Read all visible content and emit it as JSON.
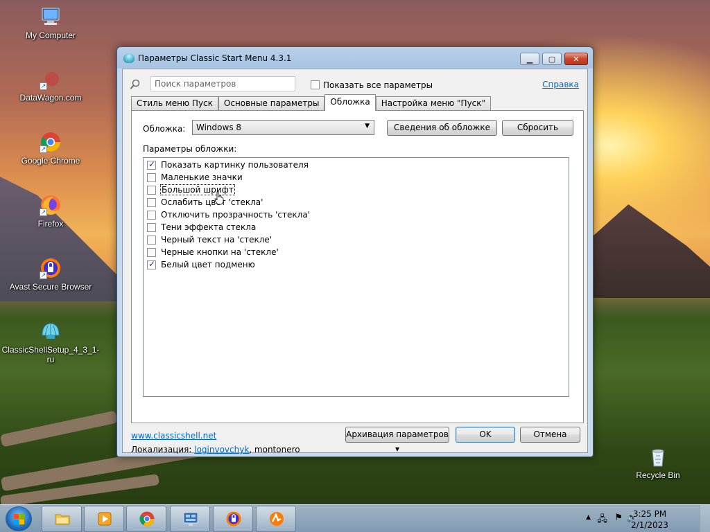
{
  "desktop": {
    "icons": [
      {
        "label": "My Computer",
        "icon": "computer-icon"
      },
      {
        "label": "DataWagon.com",
        "icon": "web-shortcut-icon"
      },
      {
        "label": "Google Chrome",
        "icon": "chrome-icon"
      },
      {
        "label": "Firefox",
        "icon": "firefox-icon"
      },
      {
        "label": "Avast Secure Browser",
        "icon": "avast-browser-icon"
      },
      {
        "label": "ClassicShellSetup_4_3_1-ru",
        "icon": "classic-shell-icon"
      }
    ],
    "recycle_bin": {
      "label": "Recycle Bin",
      "icon": "recycle-bin-icon"
    }
  },
  "window": {
    "title": "Параметры Classic Start Menu 4.3.1",
    "buttons": {
      "minimize": "▁",
      "maximize": "▢",
      "close": "✕"
    },
    "search": {
      "placeholder": "Поиск параметров"
    },
    "show_all": {
      "label": "Показать все параметры",
      "checked": false
    },
    "help_link": "Справка",
    "tabs": [
      {
        "label": "Стиль меню Пуск",
        "active": false
      },
      {
        "label": "Основные параметры",
        "active": false
      },
      {
        "label": "Обложка",
        "active": true
      },
      {
        "label": "Настройка меню \"Пуск\"",
        "active": false
      }
    ],
    "skin": {
      "label": "Обложка:",
      "selected": "Windows 8",
      "info_button": "Сведения об обложке",
      "reset_button": "Сбросить"
    },
    "skin_params_label": "Параметры обложки:",
    "skin_options": [
      {
        "label": "Показать картинку пользователя",
        "checked": true
      },
      {
        "label": "Маленькие значки",
        "checked": false
      },
      {
        "label": "Большой шрифт",
        "checked": false,
        "focused": true
      },
      {
        "label": "Ослабить цвет 'стекла'",
        "checked": false
      },
      {
        "label": "Отключить прозрачность 'стекла'",
        "checked": false
      },
      {
        "label": "Тени эффекта стекла",
        "checked": false
      },
      {
        "label": "Черный текст на 'стекле'",
        "checked": false
      },
      {
        "label": "Черные кнопки на 'стекле'",
        "checked": false
      },
      {
        "label": "Белый цвет подменю",
        "checked": true
      }
    ],
    "footer": {
      "website": "www.classicshell.net",
      "localization_label": "Локализация:",
      "localization_author1": "loginvovchyk",
      "localization_sep": ",",
      "localization_author2": "montonero",
      "backup_button": "Архивация параметров ▾",
      "ok_button": "OK",
      "cancel_button": "Отмена"
    }
  },
  "taskbar": {
    "apps": [
      {
        "name": "explorer",
        "icon": "folder-icon"
      },
      {
        "name": "media-player",
        "icon": "media-player-icon"
      },
      {
        "name": "chrome",
        "icon": "chrome-icon"
      },
      {
        "name": "control-panel",
        "icon": "control-panel-icon"
      },
      {
        "name": "avast",
        "icon": "avast-browser-icon"
      },
      {
        "name": "avast-antivirus",
        "icon": "avast-icon"
      }
    ],
    "tray": {
      "time": "3:25 PM",
      "date": "2/1/2023"
    }
  }
}
